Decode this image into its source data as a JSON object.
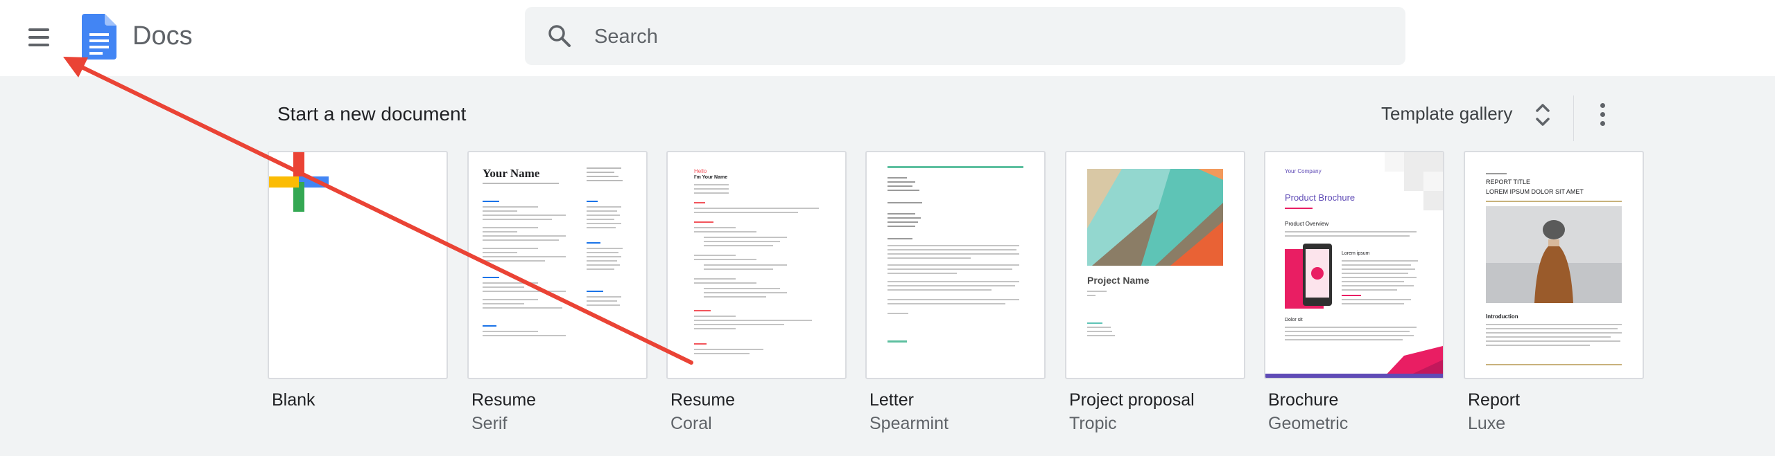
{
  "header": {
    "app_title": "Docs",
    "search_placeholder": "Search",
    "menu_icon": "hamburger-menu-icon",
    "logo_icon": "google-docs-logo-icon",
    "search_icon": "search-icon"
  },
  "section": {
    "title": "Start a new document",
    "gallery_label": "Template gallery",
    "gallery_icon": "unfold-more-icon",
    "more_icon": "more-vert-icon"
  },
  "templates": [
    {
      "name": "Blank",
      "subtitle": ""
    },
    {
      "name": "Resume",
      "subtitle": "Serif"
    },
    {
      "name": "Resume",
      "subtitle": "Coral"
    },
    {
      "name": "Letter",
      "subtitle": "Spearmint"
    },
    {
      "name": "Project proposal",
      "subtitle": "Tropic"
    },
    {
      "name": "Brochure",
      "subtitle": "Geometric"
    },
    {
      "name": "Report",
      "subtitle": "Luxe"
    }
  ],
  "thumbnails": {
    "serif": {
      "heading": "Your Name"
    },
    "coral": {
      "title": "Hello",
      "subtitle": "I'm Your Name"
    },
    "proposal": {
      "title": "Project Name"
    },
    "brochure": {
      "company": "Your Company",
      "title": "Product Brochure",
      "overview": "Product Overview",
      "lorem": "Lorem ipsum",
      "specs": "Dolor sit"
    },
    "report": {
      "label": "REPORT TITLE",
      "subtitle": "LOREM IPSUM DOLOR SIT AMET",
      "intro": "Introduction"
    }
  },
  "colors": {
    "annotation_arrow": "#ea4335",
    "docs_blue": "#4285f4",
    "plus_red": "#ea4335",
    "plus_blue": "#4285f4",
    "plus_green": "#34a853",
    "plus_yellow": "#fbbc04"
  }
}
